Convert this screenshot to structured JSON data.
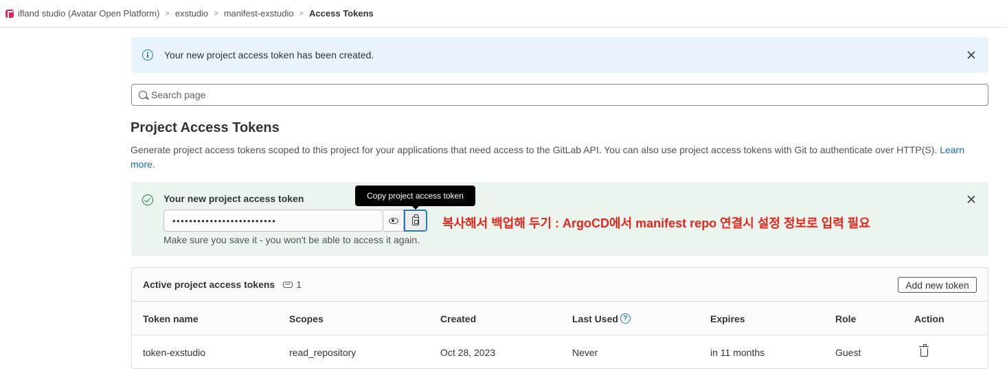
{
  "breadcrumb": {
    "items": [
      "ifland studio (Avatar Open Platform)",
      "exstudio",
      "manifest-exstudio"
    ],
    "current": "Access Tokens",
    "separator": ">"
  },
  "info_alert": {
    "message": "Your new project access token has been created."
  },
  "search": {
    "placeholder": "Search page"
  },
  "page": {
    "title": "Project Access Tokens",
    "description": "Generate project access tokens scoped to this project for your applications that need access to the GitLab API. You can also use project access tokens with Git to authenticate over HTTP(S).",
    "learn_more": "Learn more."
  },
  "new_token_alert": {
    "title": "Your new project access token",
    "masked_value": "•••••••••••••••••••••••••",
    "note": "Make sure you save it - you won't be able to access it again.",
    "tooltip": "Copy project access token",
    "annotation": "복사해서 백업해 두기 : ArgoCD에서 manifest repo 연결시 설정 정보로 입력 필요"
  },
  "active_tokens": {
    "title": "Active project access tokens",
    "count": "1",
    "add_button": "Add new token",
    "columns": [
      "Token name",
      "Scopes",
      "Created",
      "Last Used",
      "Expires",
      "Role",
      "Action"
    ],
    "help_glyph": "?",
    "rows": [
      {
        "name": "token-exstudio",
        "scopes": "read_repository",
        "created": "Oct 28, 2023",
        "last_used": "Never",
        "expires": "in 11 months",
        "role": "Guest"
      }
    ]
  },
  "colors": {
    "info_bg": "#e9f3fc",
    "success_bg": "#ecf4ee",
    "link": "#1068bf",
    "annotation": "#e8251c",
    "focus": "#1f75cb"
  }
}
